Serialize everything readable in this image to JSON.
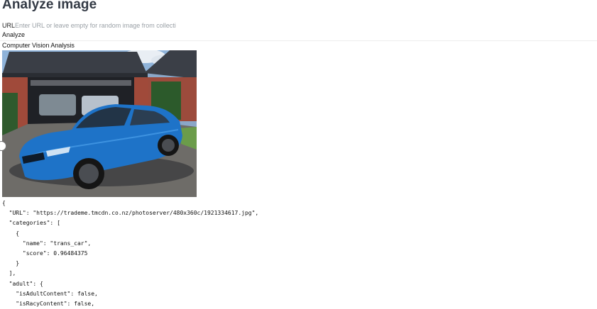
{
  "page": {
    "title": "Analyze image"
  },
  "url_field": {
    "label": "URL",
    "placeholder": "Enter URL or leave empty for random image from collecti",
    "value": ""
  },
  "analyze_button": {
    "label": "Analyze"
  },
  "results": {
    "heading": "Computer Vision Analysis",
    "json_text": "{\n  \"URL\": \"https://trademe.tmcdn.co.nz/photoserver/480x360c/1921334617.jpg\",\n  \"categories\": [\n    {\n      \"name\": \"trans_car\",\n      \"score\": 0.96484375\n    }\n  ],\n  \"adult\": {\n    \"isAdultContent\": false,\n    \"isRacyContent\": false,"
  },
  "icons": {
    "scroll_handle": "circle-handle-icon"
  }
}
